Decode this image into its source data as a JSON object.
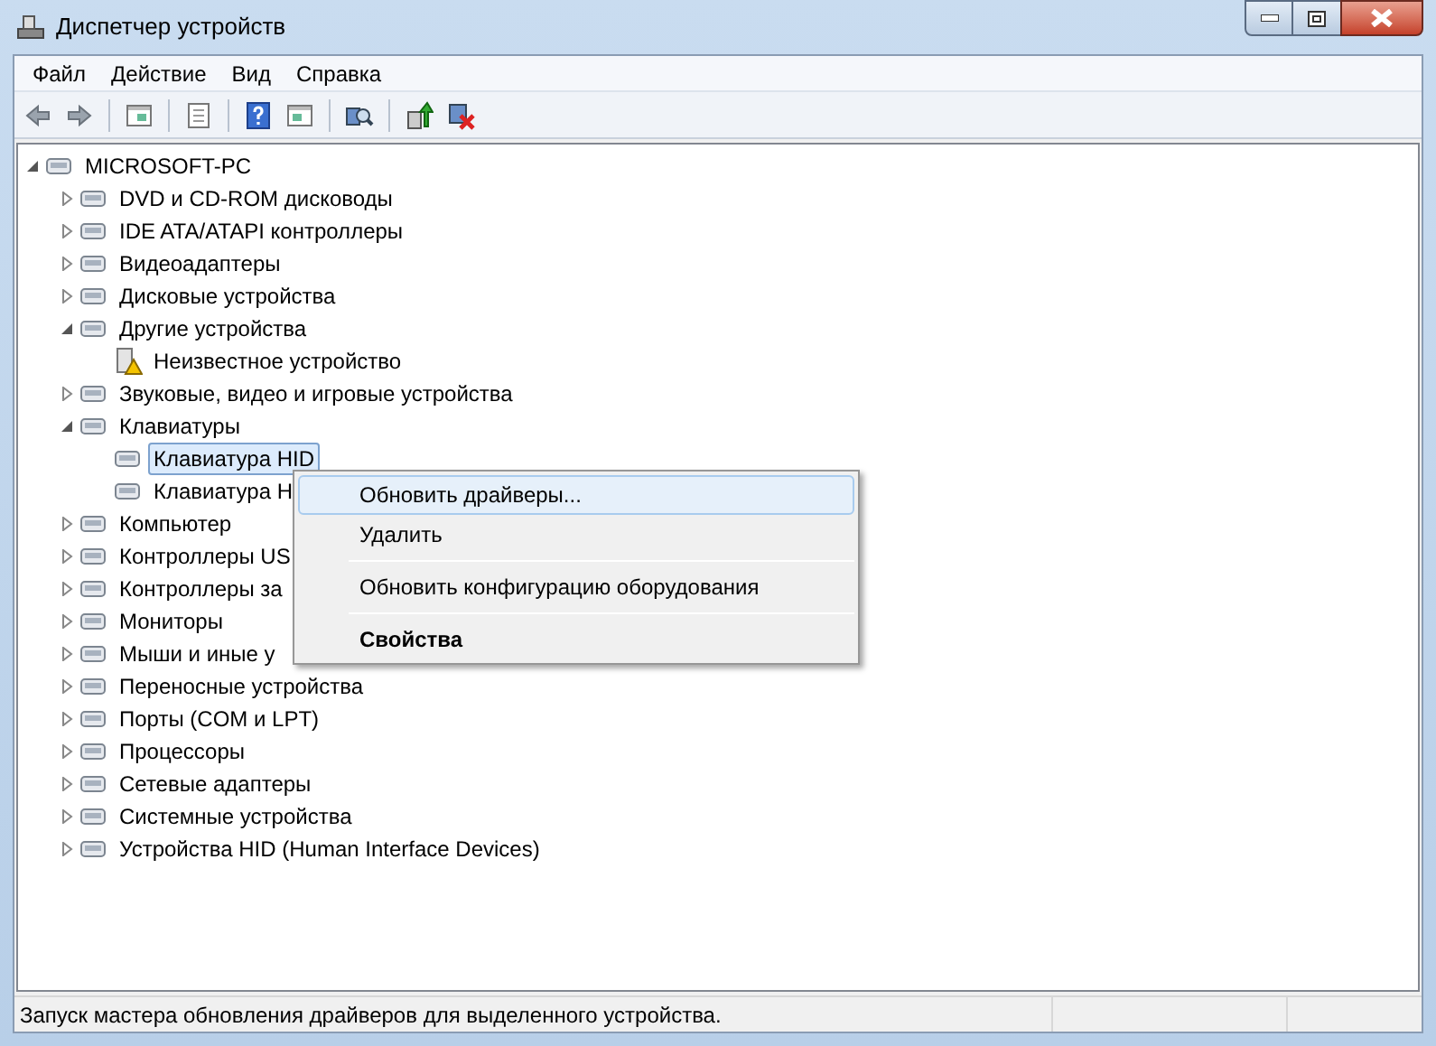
{
  "window": {
    "title": "Диспетчер устройств"
  },
  "menu_bar": [
    "Файл",
    "Действие",
    "Вид",
    "Справка"
  ],
  "tree": {
    "label": "MICROSOFT-PC",
    "expanded": true,
    "children": [
      {
        "label": "DVD и CD-ROM дисководы",
        "expanded": false
      },
      {
        "label": "IDE ATA/ATAPI контроллеры",
        "expanded": false
      },
      {
        "label": "Видеоадаптеры",
        "expanded": false
      },
      {
        "label": "Дисковые устройства",
        "expanded": false
      },
      {
        "label": "Другие устройства",
        "expanded": true,
        "children": [
          {
            "label": "Неизвестное устройство",
            "warning": true,
            "selected": false
          }
        ]
      },
      {
        "label": "Звуковые, видео и игровые устройства",
        "expanded": false
      },
      {
        "label": "Клавиатуры",
        "expanded": true,
        "children": [
          {
            "label": "Клавиатура HID",
            "selected": true
          },
          {
            "label": "Клавиатура H",
            "selected": false
          }
        ]
      },
      {
        "label": "Компьютер",
        "expanded": false
      },
      {
        "label": "Контроллеры US",
        "expanded": false
      },
      {
        "label": "Контроллеры за",
        "expanded": false
      },
      {
        "label": "Мониторы",
        "expanded": false
      },
      {
        "label": "Мыши и иные у",
        "expanded": false
      },
      {
        "label": "Переносные устройства",
        "expanded": false
      },
      {
        "label": "Порты (COM и LPT)",
        "expanded": false
      },
      {
        "label": "Процессоры",
        "expanded": false
      },
      {
        "label": "Сетевые адаптеры",
        "expanded": false
      },
      {
        "label": "Системные устройства",
        "expanded": false
      },
      {
        "label": "Устройства HID (Human Interface Devices)",
        "expanded": false
      }
    ]
  },
  "context_menu": [
    {
      "kind": "item",
      "label": "Обновить драйверы...",
      "selected": true,
      "default": false
    },
    {
      "kind": "item",
      "label": "Удалить",
      "selected": false,
      "default": false
    },
    {
      "kind": "separator"
    },
    {
      "kind": "item",
      "label": "Обновить конфигурацию оборудования",
      "selected": false,
      "default": false
    },
    {
      "kind": "separator"
    },
    {
      "kind": "item",
      "label": "Свойства",
      "selected": false,
      "default": true
    }
  ],
  "status_bar": "Запуск мастера обновления драйверов для выделенного устройства."
}
